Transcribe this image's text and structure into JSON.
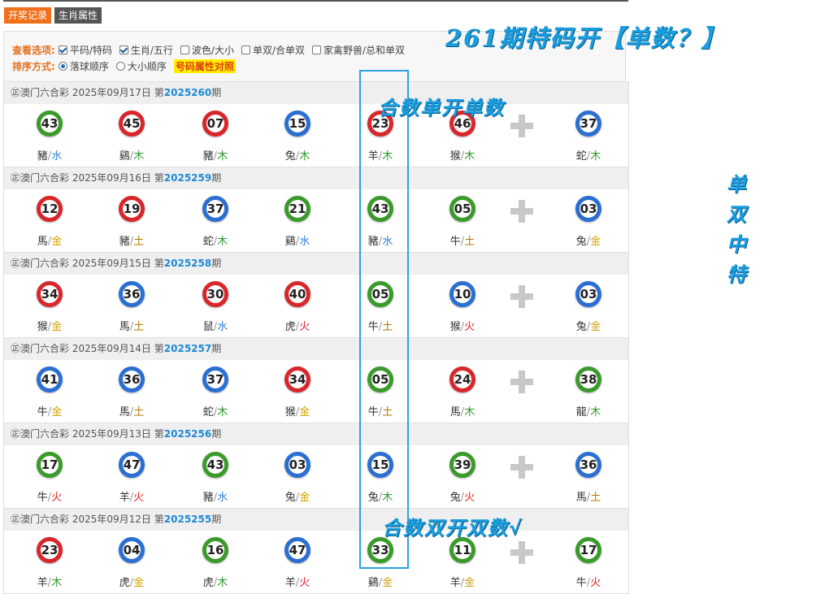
{
  "tabs": [
    "开奖记录",
    "生肖属性"
  ],
  "options": {
    "view_label": "查看选项:",
    "view_options": [
      {
        "label": "平码/特码",
        "checked": true
      },
      {
        "label": "生肖/五行",
        "checked": true
      },
      {
        "label": "波色/大小",
        "checked": false
      },
      {
        "label": "单双/合单双",
        "checked": false
      },
      {
        "label": "家禽野兽/总和单双",
        "checked": false
      }
    ],
    "sort_label": "排序方式:",
    "sort_options": [
      {
        "label": "落球顺序",
        "selected": true
      },
      {
        "label": "大小顺序",
        "selected": false
      }
    ],
    "attr_link": "号码属性对照"
  },
  "draws": [
    {
      "lottery": "㊣澳门六合彩",
      "date": "2025年09月17日",
      "prefix": "第",
      "period": "2025260",
      "suffix": "期",
      "balls": [
        {
          "num": "43",
          "color": "green",
          "zodiac": "豬",
          "element": "水"
        },
        {
          "num": "45",
          "color": "red",
          "zodiac": "鷄",
          "element": "木"
        },
        {
          "num": "07",
          "color": "red",
          "zodiac": "豬",
          "element": "木"
        },
        {
          "num": "15",
          "color": "blue",
          "zodiac": "兔",
          "element": "木"
        },
        {
          "num": "23",
          "color": "red",
          "zodiac": "羊",
          "element": "木"
        },
        {
          "num": "46",
          "color": "red",
          "zodiac": "猴",
          "element": "木"
        },
        {
          "num": "37",
          "color": "blue",
          "zodiac": "蛇",
          "element": "木"
        }
      ]
    },
    {
      "lottery": "㊣澳门六合彩",
      "date": "2025年09月16日",
      "prefix": "第",
      "period": "2025259",
      "suffix": "期",
      "balls": [
        {
          "num": "12",
          "color": "red",
          "zodiac": "馬",
          "element": "金"
        },
        {
          "num": "19",
          "color": "red",
          "zodiac": "豬",
          "element": "土"
        },
        {
          "num": "37",
          "color": "blue",
          "zodiac": "蛇",
          "element": "木"
        },
        {
          "num": "21",
          "color": "green",
          "zodiac": "鷄",
          "element": "水"
        },
        {
          "num": "43",
          "color": "green",
          "zodiac": "豬",
          "element": "水"
        },
        {
          "num": "05",
          "color": "green",
          "zodiac": "牛",
          "element": "土"
        },
        {
          "num": "03",
          "color": "blue",
          "zodiac": "兔",
          "element": "金"
        }
      ]
    },
    {
      "lottery": "㊣澳门六合彩",
      "date": "2025年09月15日",
      "prefix": "第",
      "period": "2025258",
      "suffix": "期",
      "balls": [
        {
          "num": "34",
          "color": "red",
          "zodiac": "猴",
          "element": "金"
        },
        {
          "num": "36",
          "color": "blue",
          "zodiac": "馬",
          "element": "土"
        },
        {
          "num": "30",
          "color": "red",
          "zodiac": "鼠",
          "element": "水"
        },
        {
          "num": "40",
          "color": "red",
          "zodiac": "虎",
          "element": "火"
        },
        {
          "num": "05",
          "color": "green",
          "zodiac": "牛",
          "element": "土"
        },
        {
          "num": "10",
          "color": "blue",
          "zodiac": "猴",
          "element": "火"
        },
        {
          "num": "03",
          "color": "blue",
          "zodiac": "兔",
          "element": "金"
        }
      ]
    },
    {
      "lottery": "㊣澳门六合彩",
      "date": "2025年09月14日",
      "prefix": "第",
      "period": "2025257",
      "suffix": "期",
      "balls": [
        {
          "num": "41",
          "color": "blue",
          "zodiac": "牛",
          "element": "金"
        },
        {
          "num": "36",
          "color": "blue",
          "zodiac": "馬",
          "element": "土"
        },
        {
          "num": "37",
          "color": "blue",
          "zodiac": "蛇",
          "element": "木"
        },
        {
          "num": "34",
          "color": "red",
          "zodiac": "猴",
          "element": "金"
        },
        {
          "num": "05",
          "color": "green",
          "zodiac": "牛",
          "element": "土"
        },
        {
          "num": "24",
          "color": "red",
          "zodiac": "馬",
          "element": "木"
        },
        {
          "num": "38",
          "color": "green",
          "zodiac": "龍",
          "element": "木"
        }
      ]
    },
    {
      "lottery": "㊣澳门六合彩",
      "date": "2025年09月13日",
      "prefix": "第",
      "period": "2025256",
      "suffix": "期",
      "balls": [
        {
          "num": "17",
          "color": "green",
          "zodiac": "牛",
          "element": "火"
        },
        {
          "num": "47",
          "color": "blue",
          "zodiac": "羊",
          "element": "火"
        },
        {
          "num": "43",
          "color": "green",
          "zodiac": "豬",
          "element": "水"
        },
        {
          "num": "03",
          "color": "blue",
          "zodiac": "兔",
          "element": "金"
        },
        {
          "num": "15",
          "color": "blue",
          "zodiac": "兔",
          "element": "木"
        },
        {
          "num": "39",
          "color": "green",
          "zodiac": "兔",
          "element": "火"
        },
        {
          "num": "36",
          "color": "blue",
          "zodiac": "馬",
          "element": "土"
        }
      ]
    },
    {
      "lottery": "㊣澳门六合彩",
      "date": "2025年09月12日",
      "prefix": "第",
      "period": "2025255",
      "suffix": "期",
      "balls": [
        {
          "num": "23",
          "color": "red",
          "zodiac": "羊",
          "element": "木"
        },
        {
          "num": "04",
          "color": "blue",
          "zodiac": "虎",
          "element": "金"
        },
        {
          "num": "16",
          "color": "green",
          "zodiac": "虎",
          "element": "木"
        },
        {
          "num": "47",
          "color": "blue",
          "zodiac": "羊",
          "element": "火"
        },
        {
          "num": "33",
          "color": "green",
          "zodiac": "鷄",
          "element": "金"
        },
        {
          "num": "11",
          "color": "green",
          "zodiac": "羊",
          "element": "金"
        },
        {
          "num": "17",
          "color": "green",
          "zodiac": "牛",
          "element": "火"
        }
      ]
    }
  ],
  "annotations": {
    "title": "261期特码开【单数？】",
    "note_top": "合数单开单数",
    "note_bottom": "合数双开双数√",
    "side_lines": [
      "单",
      "双",
      "中",
      "特"
    ]
  },
  "colors": {
    "red": "#d9262a",
    "blue": "#2a6fd1",
    "green": "#3a9a2a",
    "accent": "#f0701a",
    "annotation": "#1a9ee0"
  }
}
